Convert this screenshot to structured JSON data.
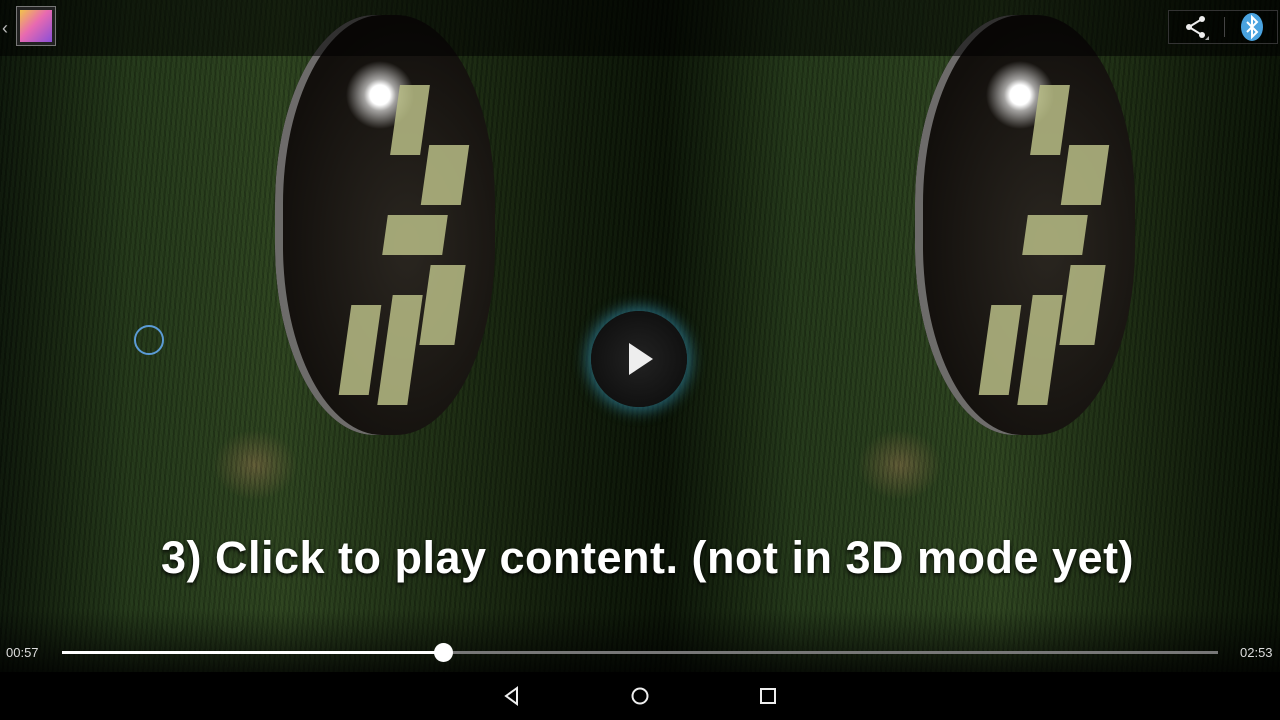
{
  "caption": "3) Click to play content. (not in 3D mode yet)",
  "player": {
    "current_time": "00:57",
    "total_time": "02:53",
    "progress_fraction": 0.33
  },
  "icons": {
    "back": "chevron-left-icon",
    "app": "gallery-app-icon",
    "share": "share-icon",
    "bluetooth": "bluetooth-icon",
    "play": "play-icon",
    "nav_back": "back-triangle-icon",
    "nav_home": "home-circle-icon",
    "nav_recents": "recents-square-icon"
  },
  "colors": {
    "accent_glow": "#3caad2",
    "bluetooth": "#4aa3e0",
    "cursor_ring": "#5b9bd5"
  }
}
